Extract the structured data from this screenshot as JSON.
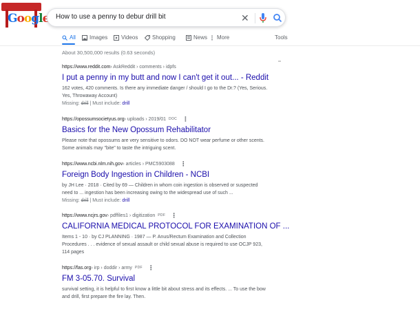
{
  "header": {
    "logo_text": "Google",
    "query": "How to use a penny to debur drill bit",
    "clear_icon": "close-icon",
    "mic_icon": "mic-icon",
    "search_icon": "search-icon"
  },
  "tabs": [
    {
      "label": "All",
      "icon": "search-icon",
      "active": true
    },
    {
      "label": "Images",
      "icon": "image-icon"
    },
    {
      "label": "Videos",
      "icon": "video-icon"
    },
    {
      "label": "Shopping",
      "icon": "tag-icon"
    },
    {
      "label": "News",
      "icon": "news-icon"
    },
    {
      "label": "More",
      "icon": "more-vert-icon"
    }
  ],
  "tools_label": "Tools",
  "stats": "About 30,500,000 results (0.63 seconds)",
  "results": [
    {
      "url_domain": "https://www.reddit.com",
      "url_path": " › AskReddit › comments › idpfs",
      "badge": "",
      "title": "I put a penny in my butt and now I can't get it out... - Reddit",
      "snippet_1": "162 votes, 420 comments. Is there any immediate danger / should I go to the Dr.? (Yes, Serious.",
      "snippet_2": "Yes, Throwaway Account)",
      "missing_label": "Missing: ",
      "missing_word": "drill",
      "must_label": " | Must include: ",
      "must_word": "drill"
    },
    {
      "url_domain": "https://opossumsocietyus.org",
      "url_path": " › uploads › 2019/01",
      "badge": "DOC",
      "title": "Basics for the New Opossum Rehabilitator",
      "snippet_1": "Please note that opossums are very sensitive to odors. DO NOT wear perfume or other scents.",
      "snippet_2": "Some animals may \"bite\" to taste the intriguing scent."
    },
    {
      "url_domain": "https://www.ncbi.nlm.nih.gov",
      "url_path": " › articles › PMC5903088",
      "badge": "",
      "title": "Foreign Body Ingestion in Children - NCBI",
      "snippet_1": "by JH Lee · 2018 · Cited by 69 — Children in whom coin ingestion is observed or suspected",
      "snippet_2": "need to ... ingestion has been increasing owing to the widespread use of such ...",
      "missing_label": "Missing: ",
      "missing_word": "drill",
      "must_label": " | Must include: ",
      "must_word": "drill"
    },
    {
      "url_domain": "https://www.ncjrs.gov",
      "url_path": " › pdffiles1 › digitization",
      "badge": "PDF",
      "title": "CALIFORNIA MEDICAL PROTOCOL FOR EXAMINATION OF ...",
      "snippet_1": "Items 1 - 10 · by CJ PLANNING · 1987 — P. Anus/Rectum Examination and Collection",
      "snippet_2": "Procedures . . . evidence of sexual assault or child sexual abuse is required to use OCJP 923,",
      "snippet_3": "114 pages"
    },
    {
      "url_domain": "https://fas.org",
      "url_path": " › irp › doddir › army",
      "badge": "PDF",
      "title": "FM 3-05.70. Survival",
      "snippet_1": "survival setting, it is helpful to first know a little bit about stress and its effects. ... To use the bow",
      "snippet_2": "and drill, first prepare the fire lay. Then."
    }
  ],
  "colors": {
    "link": "#1a0dab",
    "accent": "#1a73e8",
    "muted": "#70757a"
  }
}
